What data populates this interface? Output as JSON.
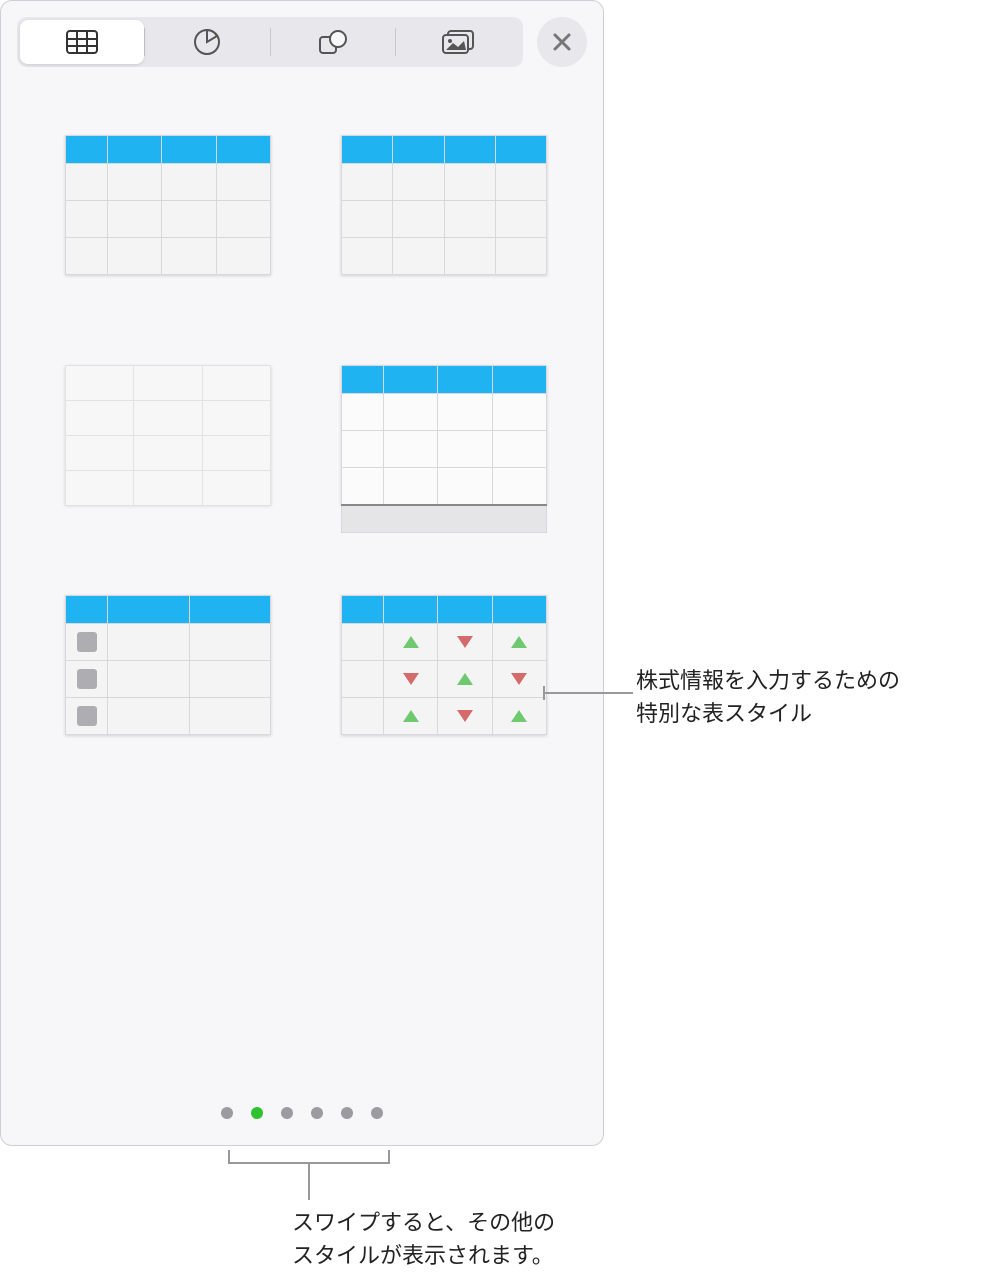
{
  "toolbar": {
    "tabs": [
      {
        "id": "table",
        "active": true
      },
      {
        "id": "chart",
        "active": false
      },
      {
        "id": "shape",
        "active": false
      },
      {
        "id": "media",
        "active": false
      }
    ]
  },
  "styles": [
    {
      "id": "header-blue-1"
    },
    {
      "id": "header-blue-2"
    },
    {
      "id": "plain"
    },
    {
      "id": "header-footer"
    },
    {
      "id": "checklist"
    },
    {
      "id": "stock-arrows"
    }
  ],
  "pager": {
    "count": 6,
    "active_index": 1
  },
  "callouts": {
    "stock_style": "株式情報を入力するための\n特別な表スタイル",
    "swipe_hint": "スワイプすると、その他の\nスタイルが表示されます。"
  },
  "colors": {
    "header_blue": "#1fb3f2",
    "arrow_up": "#6fc96f",
    "arrow_down": "#d46a6a",
    "dot_active": "#30c030"
  }
}
